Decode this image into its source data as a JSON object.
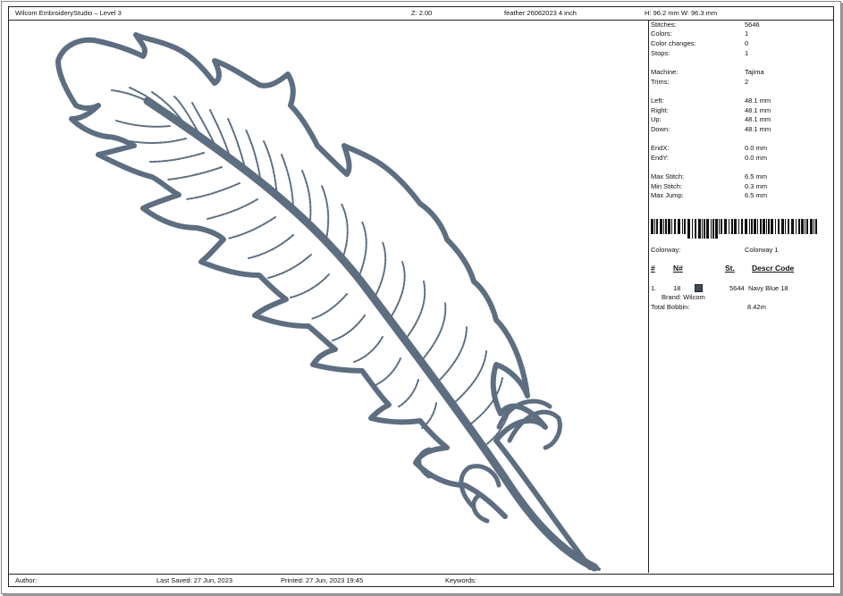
{
  "header": {
    "app_title": "Wilcom EmbroideryStudio – Level 3",
    "zoom": "Z: 2.00",
    "design_name": "feather 26062023 4 inch",
    "size": "H: 96.2 mm   W: 96.3 mm"
  },
  "stats": [
    {
      "label": "Stitches:",
      "value": "5646"
    },
    {
      "label": "Colors:",
      "value": "1"
    },
    {
      "label": "Color changes:",
      "value": "0"
    },
    {
      "label": "Stops:",
      "value": "1"
    },
    {
      "label": "Machine:",
      "value": "Tajima"
    },
    {
      "label": "Trims:",
      "value": "2"
    },
    {
      "label": "Left:",
      "value": "48.1 mm"
    },
    {
      "label": "Right:",
      "value": "48.1 mm"
    },
    {
      "label": "Up:",
      "value": "48.1 mm"
    },
    {
      "label": "Down:",
      "value": "48.1 mm"
    },
    {
      "label": "EndX:",
      "value": "0.0 mm"
    },
    {
      "label": "EndY:",
      "value": "0.0 mm"
    },
    {
      "label": "Max Stitch:",
      "value": "6.5 mm"
    },
    {
      "label": "Min Stitch:",
      "value": "0.3 mm"
    },
    {
      "label": "Max Jump:",
      "value": "6.5 mm"
    }
  ],
  "colorway": {
    "label": "Colorway:",
    "value": "Colorway 1"
  },
  "color_table": {
    "headers": {
      "num": "#",
      "n": "N#",
      "st": "St.",
      "descr_code": "Descr  Code"
    },
    "rows": [
      {
        "num": "1.",
        "n": "18",
        "swatch": "#3d4a5a",
        "st": "5644",
        "descr": "Navy Blue 18",
        "brand": "Brand: Wilcom"
      }
    ],
    "bobbin_label": "Total Bobbin:",
    "bobbin_value": "8.42m"
  },
  "footer": {
    "author": "Author:",
    "last_saved": "Last Saved: 27 Jun, 2023",
    "printed": "Printed: 27 Jun, 2023 19:45",
    "keywords": "Keywords:"
  },
  "thread_color": "#5d6e80"
}
